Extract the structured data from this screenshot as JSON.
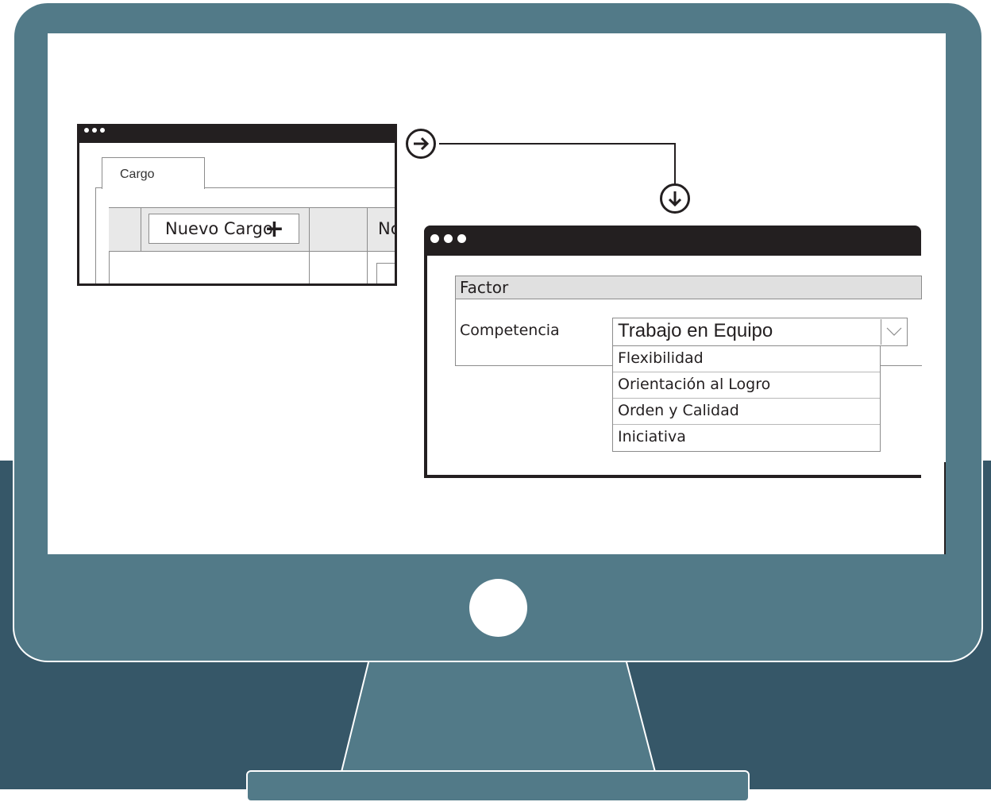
{
  "colors": {
    "monitor": "#527a88",
    "background": "#365768",
    "window_bar": "#231f20",
    "screen": "#ffffff"
  },
  "window_left": {
    "tab_label": "Cargo",
    "new_button_label": "Nuevo Cargo",
    "new_button_icon": "plus-icon",
    "column_partial_label": "Nc"
  },
  "connector": {
    "start_icon": "arrow-right-circle-icon",
    "end_icon": "arrow-down-circle-icon"
  },
  "window_right": {
    "section_title": "Factor",
    "field_label": "Competencia",
    "selected_value": "Trabajo en Equipo",
    "dropdown_icon": "chevron-down-icon",
    "options": [
      "Flexibilidad",
      "Orientación al Logro",
      "Orden y Calidad",
      "Iniciativa"
    ]
  }
}
